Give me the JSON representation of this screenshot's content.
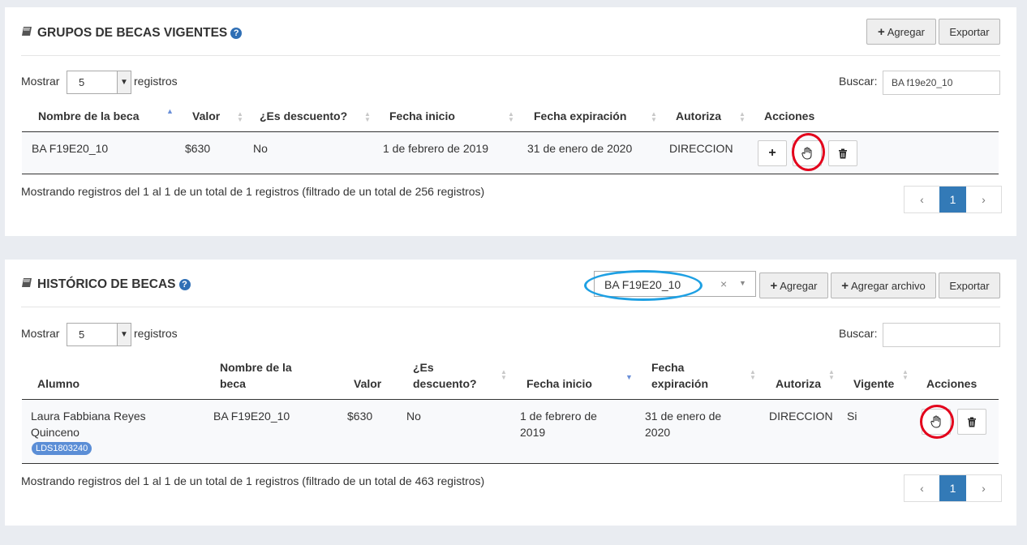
{
  "panel1": {
    "title": "GRUPOS DE BECAS VIGENTES",
    "help": "?",
    "add_label": "Agregar",
    "export_label": "Exportar",
    "show_label": "Mostrar",
    "show_value": "5",
    "records_label": "registros",
    "search_label": "Buscar:",
    "search_value": "BA f19e20_10",
    "columns": [
      "Nombre de la beca",
      "Valor",
      "¿Es descuento?",
      "Fecha inicio",
      "Fecha expiración",
      "Autoriza",
      "Acciones"
    ],
    "row": {
      "nombre": "BA F19E20_10",
      "valor": "$630",
      "descuento": "No",
      "inicio": "1 de febrero de 2019",
      "expiracion": "31 de enero de 2020",
      "autoriza": "DIRECCION"
    },
    "summary": "Mostrando registros del 1 al 1 de un total de 1 registros (filtrado de un total de 256 registros)",
    "pager": {
      "prev": "‹",
      "current": "1",
      "next": "›"
    }
  },
  "panel2": {
    "title": "HISTÓRICO DE BECAS",
    "help": "?",
    "combo_value": "BA F19E20_10",
    "combo_clear": "×",
    "add_label": "Agregar",
    "add_file_label": "Agregar archivo",
    "export_label": "Exportar",
    "show_label": "Mostrar",
    "show_value": "5",
    "records_label": "registros",
    "search_label": "Buscar:",
    "search_value": "",
    "columns": {
      "alumno": "Alumno",
      "nombre_1": "Nombre de la",
      "nombre_2": "beca",
      "valor": "Valor",
      "desc_1": "¿Es",
      "desc_2": "descuento?",
      "inicio": "Fecha inicio",
      "exp_1": "Fecha",
      "exp_2": "expiración",
      "autoriza": "Autoriza",
      "vigente": "Vigente",
      "acciones": "Acciones"
    },
    "row": {
      "alumno_1": "Laura Fabbiana Reyes",
      "alumno_2": "Quinceno",
      "badge": "LDS1803240",
      "nombre": "BA F19E20_10",
      "valor": "$630",
      "descuento": "No",
      "inicio_1": "1 de febrero de",
      "inicio_2": "2019",
      "exp_1": "31 de enero de",
      "exp_2": "2020",
      "autoriza": "DIRECCION",
      "vigente": "Si"
    },
    "summary": "Mostrando registros del 1 al 1 de un total de 1 registros (filtrado de un total de 463 registros)",
    "pager": {
      "prev": "‹",
      "current": "1",
      "next": "›"
    }
  },
  "colors": {
    "accent": "#337ab7",
    "highlight_red": "#e3001b",
    "highlight_blue": "#1ea0e3",
    "badge": "#5b8ed6"
  }
}
